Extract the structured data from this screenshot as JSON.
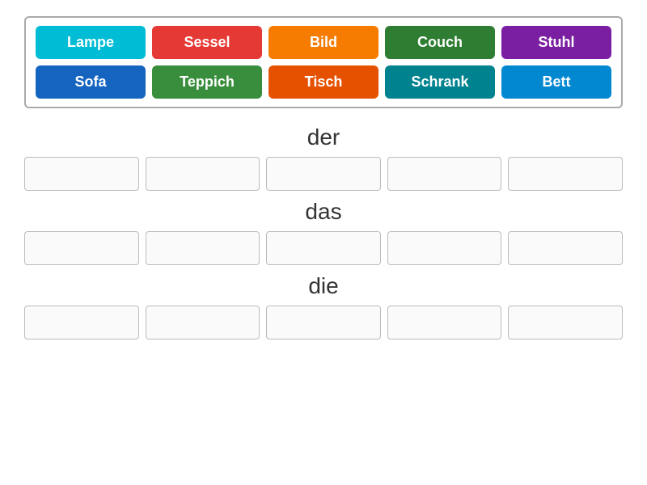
{
  "word_bank": {
    "tiles": [
      {
        "label": "Lampe",
        "color_class": "tile-cyan"
      },
      {
        "label": "Sessel",
        "color_class": "tile-red"
      },
      {
        "label": "Bild",
        "color_class": "tile-orange"
      },
      {
        "label": "Couch",
        "color_class": "tile-dkgreen"
      },
      {
        "label": "Stuhl",
        "color_class": "tile-purple"
      },
      {
        "label": "Sofa",
        "color_class": "tile-blue"
      },
      {
        "label": "Teppich",
        "color_class": "tile-green"
      },
      {
        "label": "Tisch",
        "color_class": "tile-orange2"
      },
      {
        "label": "Schrank",
        "color_class": "tile-teal"
      },
      {
        "label": "Bett",
        "color_class": "tile-ltblue"
      }
    ]
  },
  "sections": [
    {
      "id": "der",
      "label": "der"
    },
    {
      "id": "das",
      "label": "das"
    },
    {
      "id": "die",
      "label": "die"
    }
  ],
  "drop_slots": 5
}
